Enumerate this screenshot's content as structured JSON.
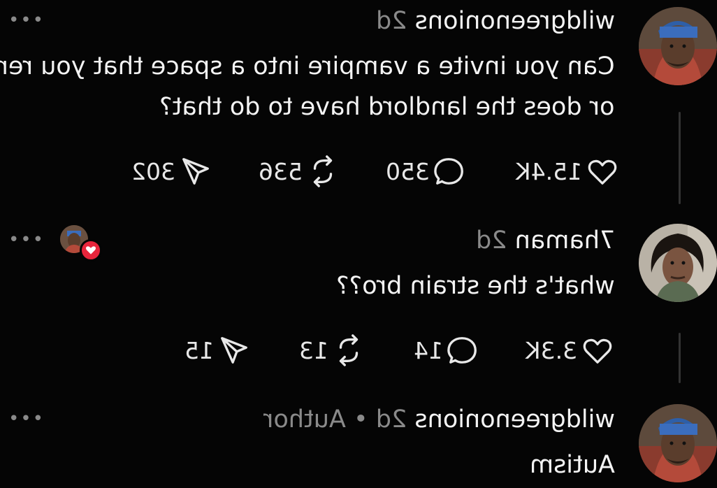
{
  "comments": [
    {
      "username": "wildgreenonions",
      "time": "2d",
      "author_tag": "",
      "text_lines": [
        "Can you invite a vampire into a space that you rent",
        "or does the landlord have to do that?"
      ],
      "likes": "15.4K",
      "replies": "350",
      "reposts": "536",
      "shares": "302"
    },
    {
      "username": "7haman",
      "time": "2d",
      "author_tag": "",
      "text_lines": [
        "what's the strain bro??"
      ],
      "likes": "3.3K",
      "replies": "14",
      "reposts": "13",
      "shares": "15"
    },
    {
      "username": "wildgreenonions",
      "time": "2d",
      "author_tag": "Author",
      "separator": "•",
      "text_lines": [
        "Autism"
      ]
    }
  ],
  "more_label": "•••",
  "icons": {
    "like": "heart-icon",
    "reply": "speech-bubble-icon",
    "repost": "repost-icon",
    "share": "send-icon",
    "liked_by_author": "heart-badge-icon"
  },
  "colors": {
    "background": "#050505",
    "text": "#f4f4f4",
    "muted": "#8a8a8a",
    "heart_badge": "#e8253c"
  }
}
